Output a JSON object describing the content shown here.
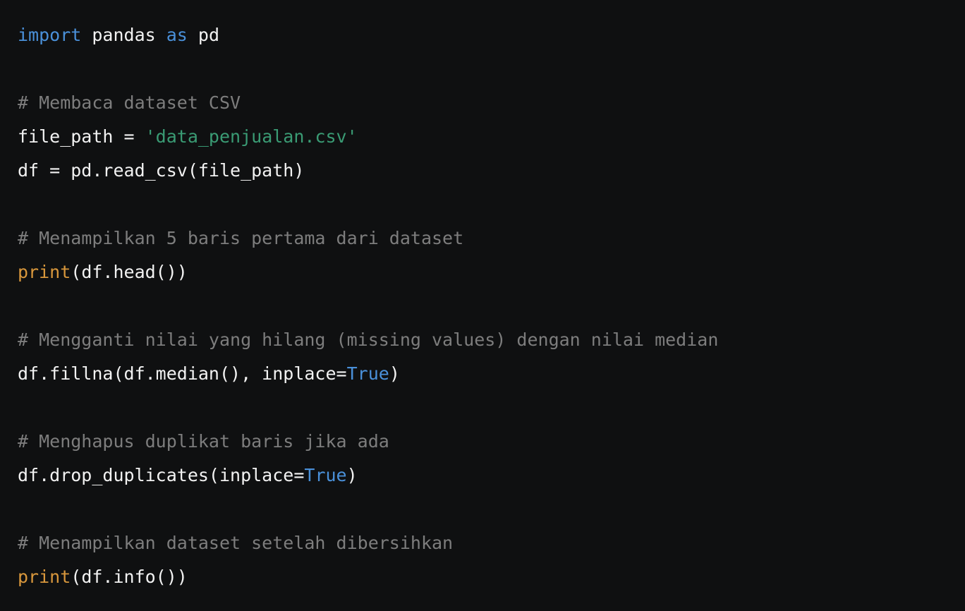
{
  "editor": {
    "language": "python",
    "background_color": "#0f1011",
    "default_text_color": "#f2f2f2",
    "token_colors": {
      "keyword": "#4a90d9",
      "comment": "#7d7d7d",
      "string": "#3a9b74",
      "builtin": "#d8973c",
      "constant": "#4a90d9",
      "plain": "#f2f2f2"
    }
  },
  "code": {
    "lines": [
      {
        "tokens": [
          {
            "text": "import",
            "type": "keyword"
          },
          {
            "text": " pandas ",
            "type": "plain"
          },
          {
            "text": "as",
            "type": "keyword"
          },
          {
            "text": " pd",
            "type": "plain"
          }
        ]
      },
      {
        "tokens": []
      },
      {
        "tokens": [
          {
            "text": "# Membaca dataset CSV",
            "type": "comment"
          }
        ]
      },
      {
        "tokens": [
          {
            "text": "file_path = ",
            "type": "plain"
          },
          {
            "text": "'data_penjualan.csv'",
            "type": "string"
          }
        ]
      },
      {
        "tokens": [
          {
            "text": "df = pd.read_csv(file_path)",
            "type": "plain"
          }
        ]
      },
      {
        "tokens": []
      },
      {
        "tokens": [
          {
            "text": "# Menampilkan 5 baris pertama dari dataset",
            "type": "comment"
          }
        ]
      },
      {
        "tokens": [
          {
            "text": "print",
            "type": "builtin"
          },
          {
            "text": "(df.head())",
            "type": "plain"
          }
        ]
      },
      {
        "tokens": []
      },
      {
        "tokens": [
          {
            "text": "# Mengganti nilai yang hilang (missing values) dengan nilai median",
            "type": "comment"
          }
        ]
      },
      {
        "tokens": [
          {
            "text": "df.fillna(df.median(), inplace=",
            "type": "plain"
          },
          {
            "text": "True",
            "type": "constant"
          },
          {
            "text": ")",
            "type": "plain"
          }
        ]
      },
      {
        "tokens": []
      },
      {
        "tokens": [
          {
            "text": "# Menghapus duplikat baris jika ada",
            "type": "comment"
          }
        ]
      },
      {
        "tokens": [
          {
            "text": "df.drop_duplicates(inplace=",
            "type": "plain"
          },
          {
            "text": "True",
            "type": "constant"
          },
          {
            "text": ")",
            "type": "plain"
          }
        ]
      },
      {
        "tokens": []
      },
      {
        "tokens": [
          {
            "text": "# Menampilkan dataset setelah dibersihkan",
            "type": "comment"
          }
        ]
      },
      {
        "tokens": [
          {
            "text": "print",
            "type": "builtin"
          },
          {
            "text": "(df.info())",
            "type": "plain"
          }
        ]
      }
    ]
  }
}
